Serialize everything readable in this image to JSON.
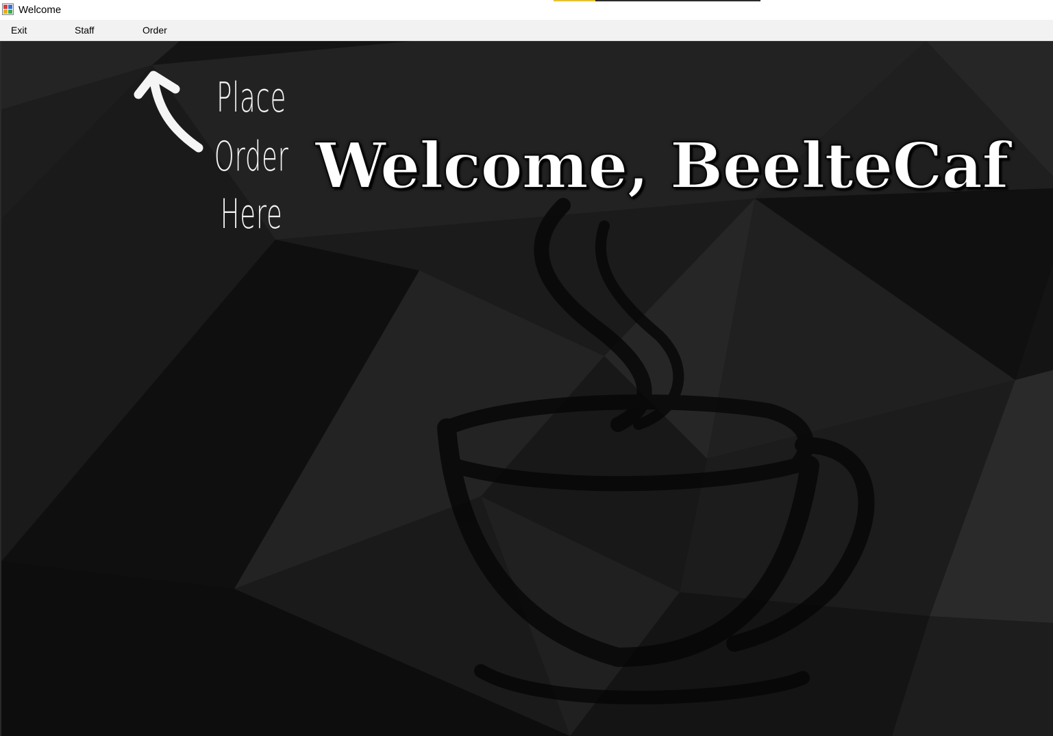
{
  "window": {
    "title": "Welcome"
  },
  "menu": {
    "items": [
      {
        "label": "Exit"
      },
      {
        "label": "Staff"
      },
      {
        "label": "Order"
      }
    ]
  },
  "hint": {
    "line1": "Place",
    "line2": "Order",
    "line3": "Here",
    "icon": "curved-arrow-up-left-icon"
  },
  "main": {
    "heading": "Welcome, BeelteCaf",
    "background_icon": "coffee-cup-icon"
  },
  "colors": {
    "background": "#151515",
    "menubar": "#f2f2f2",
    "heading_text": "#ffffff",
    "accent_yellow": "#e6c233"
  }
}
